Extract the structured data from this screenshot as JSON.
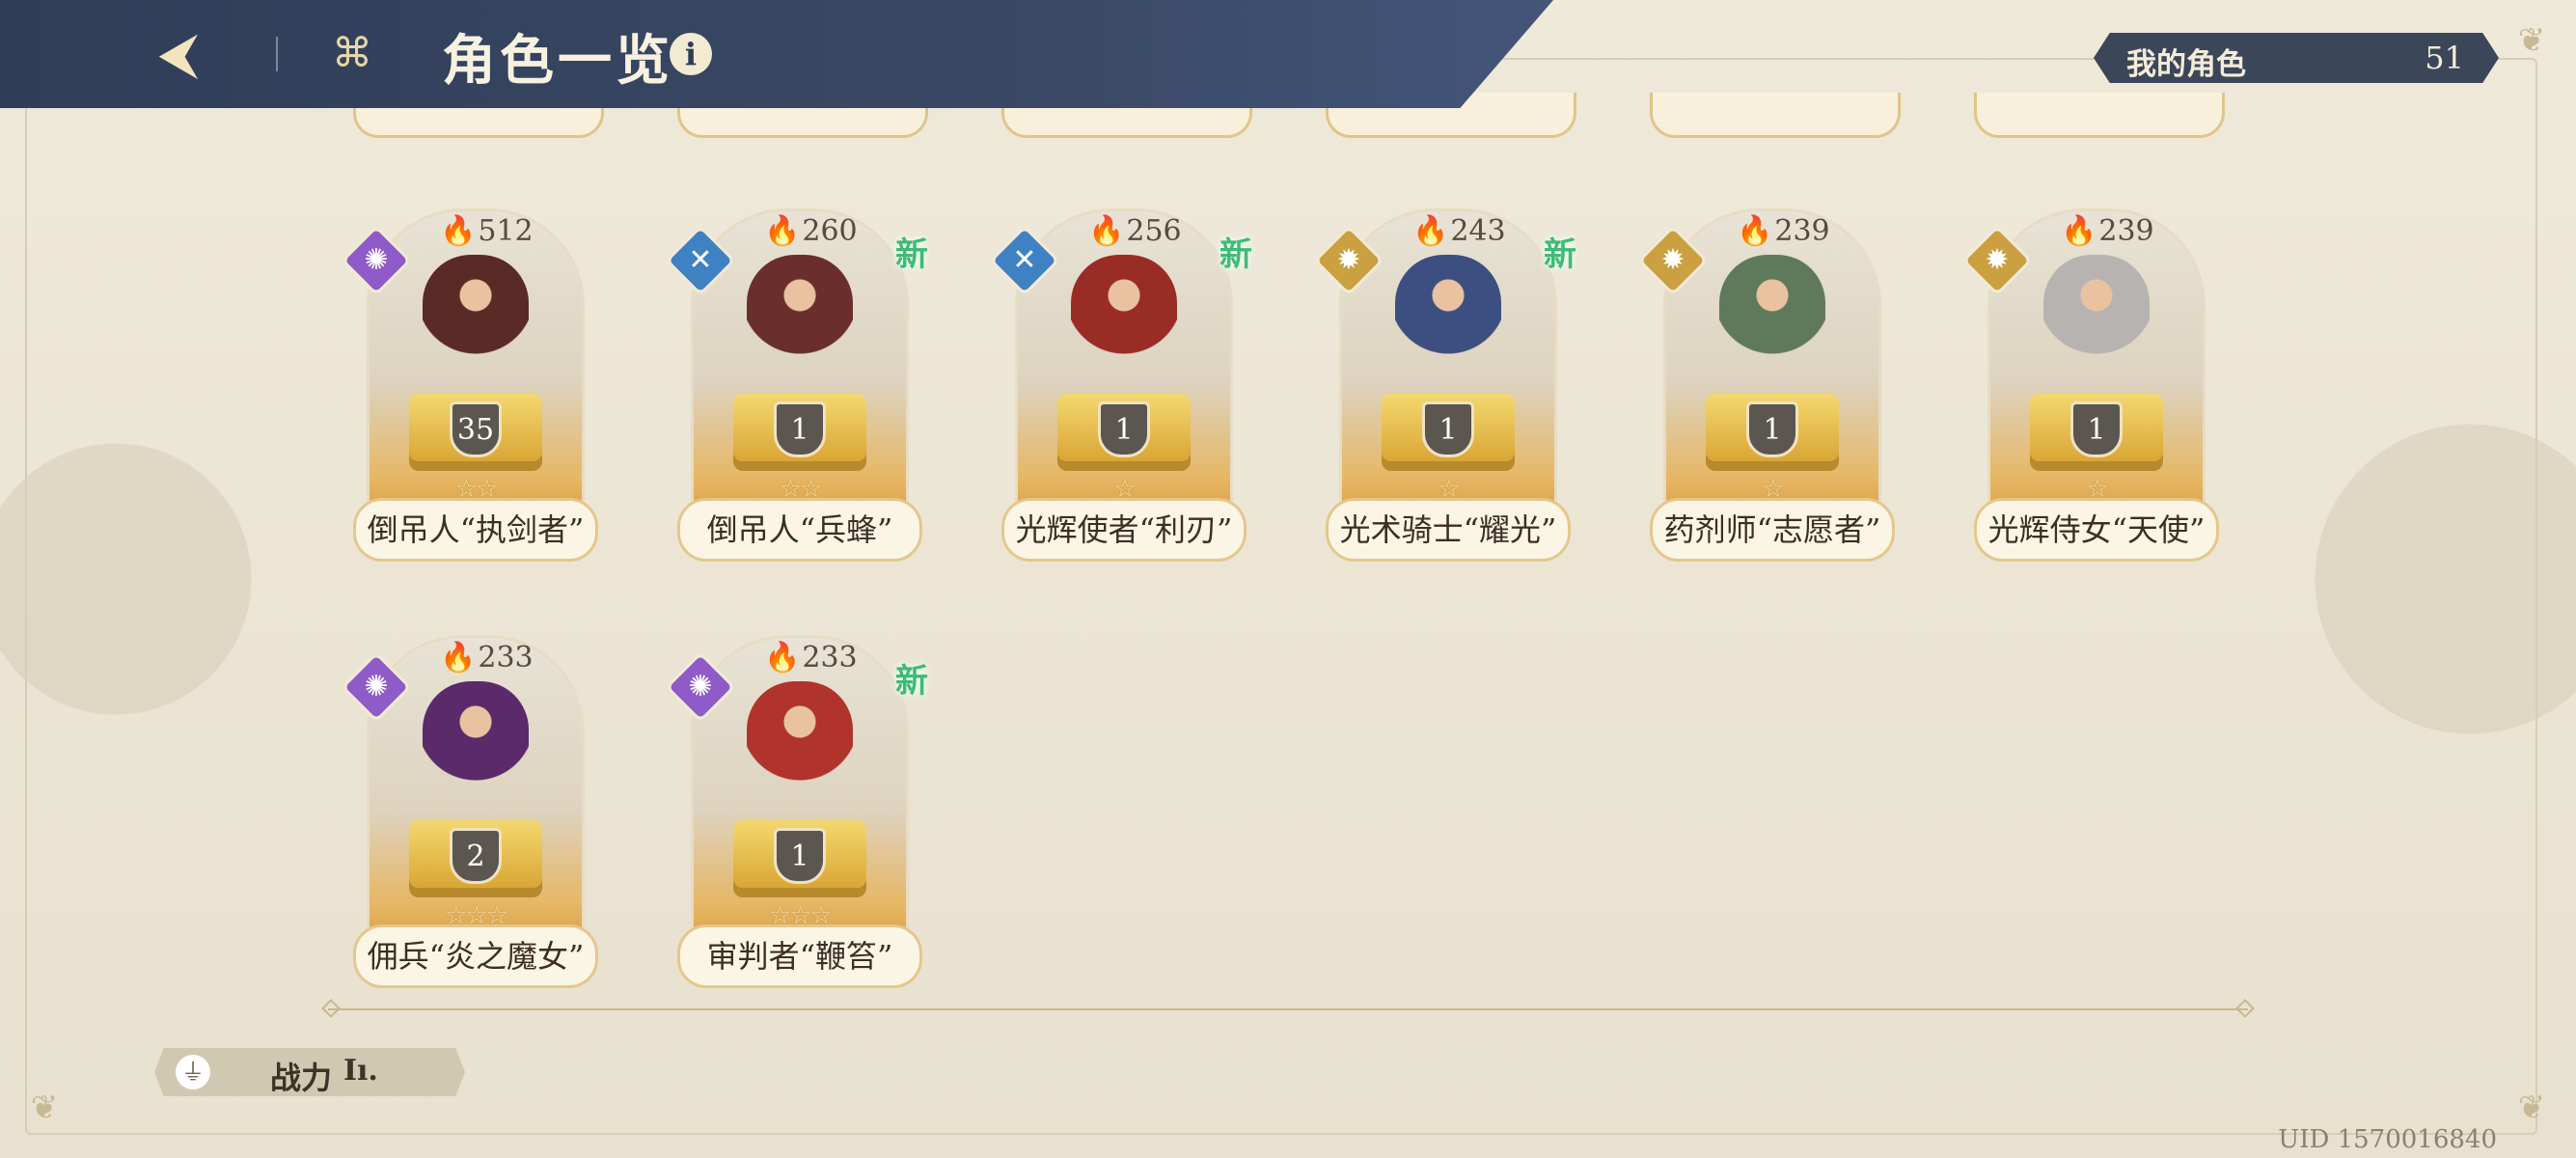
{
  "header": {
    "title": "角色一览",
    "back_icon": "back-arrow-icon",
    "menu_icon": "grid-menu-icon",
    "info_icon": "info-icon"
  },
  "my_characters": {
    "label": "我的角色",
    "count": "51"
  },
  "characters": [
    {
      "name": "倒吊人“执剑者”",
      "power": "512",
      "level": "35",
      "stars": "☆☆",
      "element": "arcane",
      "element_color": "#8e5bc8",
      "new": ""
    },
    {
      "name": "倒吊人“兵蜂”",
      "power": "260",
      "level": "1",
      "stars": "☆☆",
      "element": "wind",
      "element_color": "#3f82c4",
      "new": "新"
    },
    {
      "name": "光辉使者“利刃”",
      "power": "256",
      "level": "1",
      "stars": "☆",
      "element": "wind",
      "element_color": "#3f82c4",
      "new": "新"
    },
    {
      "name": "光术骑士“耀光”",
      "power": "243",
      "level": "1",
      "stars": "☆",
      "element": "light",
      "element_color": "#caa040",
      "new": "新"
    },
    {
      "name": "药剂师“志愿者”",
      "power": "239",
      "level": "1",
      "stars": "☆",
      "element": "light",
      "element_color": "#caa040",
      "new": ""
    },
    {
      "name": "光辉侍女“天使”",
      "power": "239",
      "level": "1",
      "stars": "☆",
      "element": "light",
      "element_color": "#caa040",
      "new": ""
    },
    {
      "name": "佣兵“炎之魔女”",
      "power": "233",
      "level": "2",
      "stars": "☆☆☆",
      "element": "arcane",
      "element_color": "#8e5bc8",
      "new": ""
    },
    {
      "name": "审判者“鞭笞”",
      "power": "233",
      "level": "1",
      "stars": "☆☆☆",
      "element": "arcane",
      "element_color": "#8e5bc8",
      "new": "新"
    }
  ],
  "filter": {
    "label": "战力",
    "sort_icon": "sort-bars-icon",
    "filter_icon": "filter-icon"
  },
  "uid": "UID 1570016840"
}
